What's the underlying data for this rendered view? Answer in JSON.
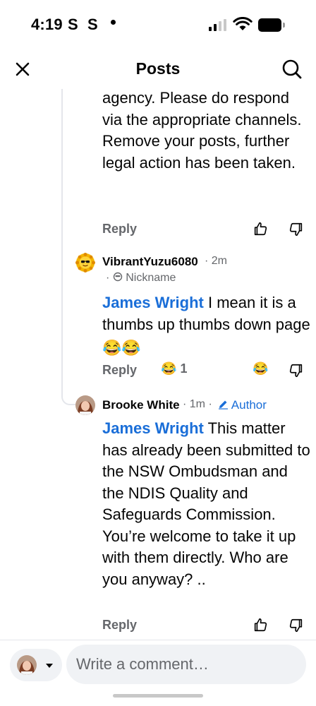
{
  "status_bar": {
    "time": "4:19",
    "app_icon_1": "S",
    "app_icon_2": "S"
  },
  "header": {
    "title": "Posts",
    "close_icon": "close-icon",
    "search_icon": "search-icon"
  },
  "comments": [
    {
      "text": "agency. Please do respond via the appropriate channels. Remove your posts, further legal action has been taken.",
      "reply_label": "Reply"
    },
    {
      "author": "VibrantYuzu6080",
      "time": "2m",
      "meta_prefix": "·",
      "badge": "Nickname",
      "mention": "James Wright",
      "text": " I mean it is a thumbs up thumbs down page ",
      "text_emoji": "😂😂",
      "reply_label": "Reply",
      "reaction_emoji": "😂",
      "reaction_count": "1",
      "reaction_emoji_right": "😂"
    },
    {
      "author": "Brooke White",
      "time": "1m",
      "badge": "Author",
      "mention": "James Wright",
      "text": " This matter has already been submitted to the NSW Ombudsman and the NDIS Quality and Safeguards Commission. You’re welcome to take it up with them directly. Who are you anyway? ..",
      "reply_label": "Reply"
    }
  ],
  "composer": {
    "placeholder": "Write a comment…"
  },
  "colors": {
    "mention": "#1a6ed8",
    "secondary_text": "#65676b",
    "input_bg": "#f0f2f5"
  }
}
